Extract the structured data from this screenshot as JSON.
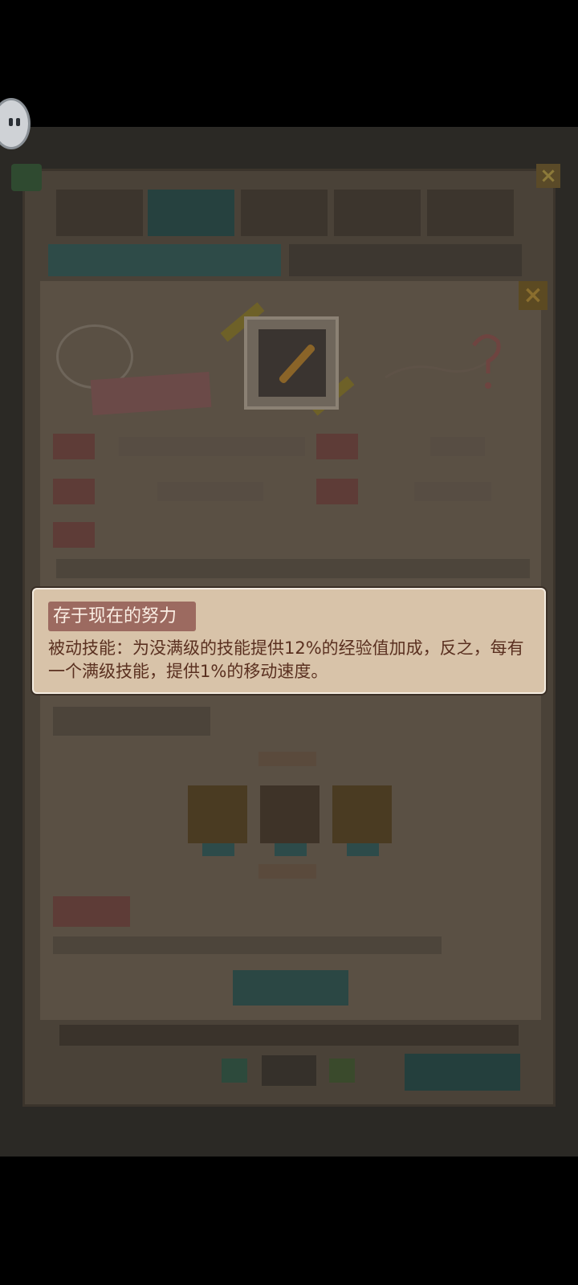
{
  "tooltip": {
    "title": "存于现在的努力",
    "description": "被动技能：为没满级的技能提供12%的经验值加成，反之，每有一个满级技能，提供1%的移动速度。"
  },
  "colors": {
    "tooltip_bg": "#d8c3a9",
    "tooltip_title_bg": "#9c6a60",
    "tooltip_text": "#5a3020",
    "overlay": "#2b2925"
  },
  "icons": [
    "close-icon",
    "blade-icon",
    "question-mark-icon",
    "minus-icon",
    "plus-icon"
  ]
}
